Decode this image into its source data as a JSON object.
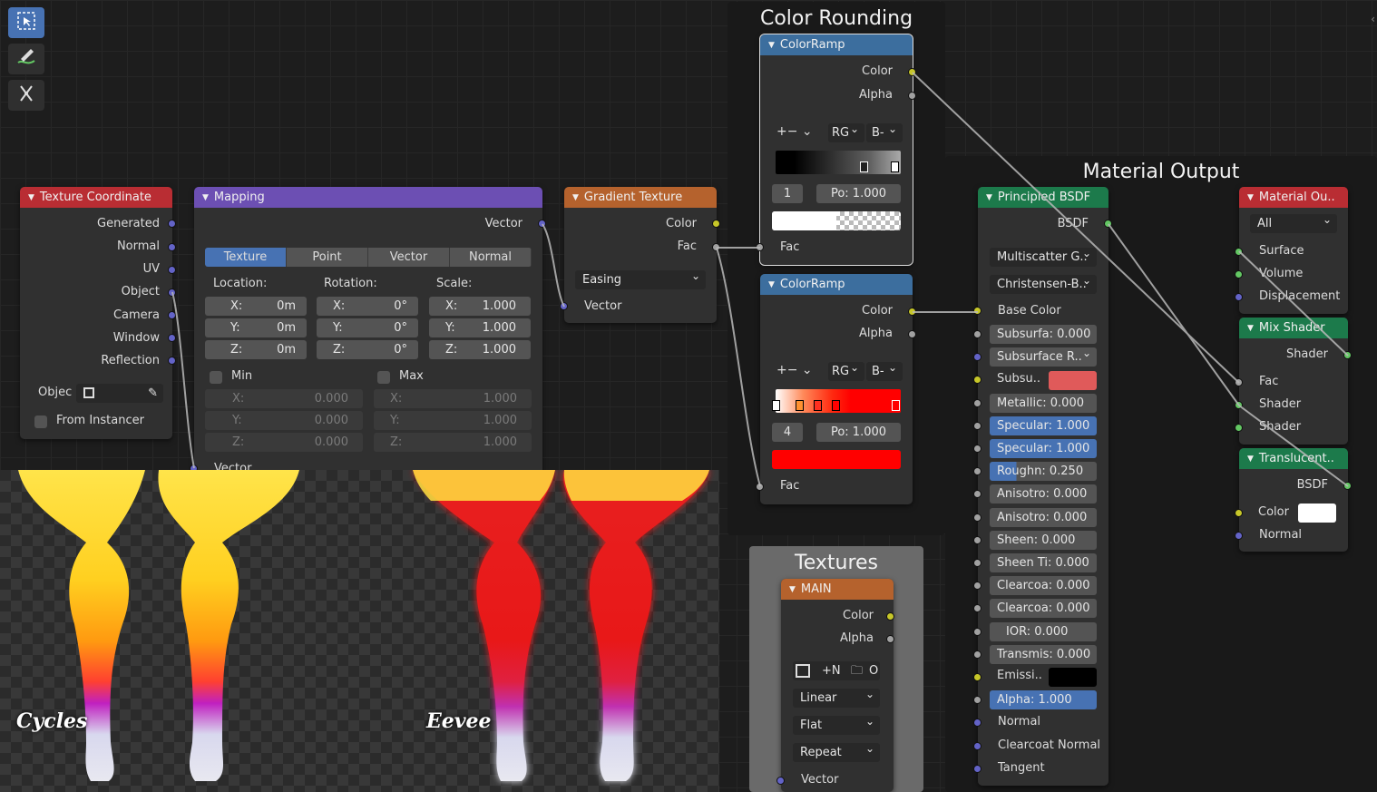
{
  "frames": {
    "color_rounding": "Color Rounding",
    "material_output": "Material Output",
    "textures": "Textures"
  },
  "toolbar": [
    "select-box-icon",
    "annotate-icon",
    "cut-links-icon"
  ],
  "texture_coordinate": {
    "title": "Texture Coordinate",
    "outputs": [
      "Generated",
      "Normal",
      "UV",
      "Object",
      "Camera",
      "Window",
      "Reflection"
    ],
    "object_label": "Objec",
    "from_instancer": "From Instancer"
  },
  "mapping": {
    "title": "Mapping",
    "output": "Vector",
    "types": [
      "Texture",
      "Point",
      "Vector",
      "Normal"
    ],
    "location_label": "Location:",
    "rotation_label": "Rotation:",
    "scale_label": "Scale:",
    "location": [
      {
        "axis": "X:",
        "value": "0m"
      },
      {
        "axis": "Y:",
        "value": "0m"
      },
      {
        "axis": "Z:",
        "value": "0m"
      }
    ],
    "rotation": [
      {
        "axis": "X:",
        "value": "0°"
      },
      {
        "axis": "Y:",
        "value": "0°"
      },
      {
        "axis": "Z:",
        "value": "0°"
      }
    ],
    "scale": [
      {
        "axis": "X:",
        "value": "1.000"
      },
      {
        "axis": "Y:",
        "value": "1.000"
      },
      {
        "axis": "Z:",
        "value": "1.000"
      }
    ],
    "min_label": "Min",
    "max_label": "Max",
    "min": [
      {
        "axis": "X:",
        "value": "0.000"
      },
      {
        "axis": "Y:",
        "value": "0.000"
      },
      {
        "axis": "Z:",
        "value": "0.000"
      }
    ],
    "max": [
      {
        "axis": "X:",
        "value": "1.000"
      },
      {
        "axis": "Y:",
        "value": "1.000"
      },
      {
        "axis": "Z:",
        "value": "1.000"
      }
    ],
    "input": "Vector"
  },
  "gradient": {
    "title": "Gradient Texture",
    "out_color": "Color",
    "out_fac": "Fac",
    "type": "Easing",
    "input": "Vector"
  },
  "ramp1": {
    "title": "ColorRamp",
    "out_color": "Color",
    "out_alpha": "Alpha",
    "add_remove": "+−",
    "color_mode": "RG",
    "interp": "B-",
    "index": "1",
    "pos": "Po: 1.000",
    "input": "Fac"
  },
  "ramp2": {
    "title": "ColorRamp",
    "out_color": "Color",
    "out_alpha": "Alpha",
    "add_remove": "+−",
    "color_mode": "RG",
    "interp": "B-",
    "index": "4",
    "pos": "Po: 1.000",
    "input": "Fac"
  },
  "image_tex": {
    "title": "MAIN",
    "out_color": "Color",
    "out_alpha": "Alpha",
    "new_label": "+N",
    "open_label": "O",
    "interpolation": "Linear",
    "projection": "Flat",
    "extension": "Repeat",
    "input": "Vector"
  },
  "principled": {
    "title": "Principled BSDF",
    "output": "BSDF",
    "distribution": "Multiscatter G..",
    "subsurface_method": "Christensen-B..",
    "base_color": "Base Color",
    "subsurface": "Subsurfa: 0.000",
    "subsurface_radius": "Subsurface R..",
    "subsurface_color": "Subsu..",
    "metallic": "Metallic:  0.000",
    "specular": "Specular: 1.000",
    "specular_tint": "Specular: 1.000",
    "roughness": "Roughn:  0.250",
    "anisotropic": "Anisotro:  0.000",
    "anisotropic_rot": "Anisotro:  0.000",
    "sheen": "Sheen:     0.000",
    "sheen_tint": "Sheen Ti: 0.000",
    "clearcoat": "Clearcoa: 0.000",
    "clearcoat_rough": "Clearcoa: 0.000",
    "ior": "IOR:      0.000",
    "transmission": "Transmis: 0.000",
    "emission": "Emissi..",
    "alpha": "Alpha:       1.000",
    "normal": "Normal",
    "clearcoat_normal": "Clearcoat Normal",
    "tangent": "Tangent"
  },
  "material_output": {
    "title": "Material Ou..",
    "target": "All",
    "inputs": [
      "Surface",
      "Volume",
      "Displacement"
    ]
  },
  "mix_shader": {
    "title": "Mix Shader",
    "output": "Shader",
    "inputs": [
      "Fac",
      "Shader",
      "Shader"
    ]
  },
  "translucent": {
    "title": "Translucent..",
    "output": "BSDF",
    "color": "Color",
    "normal": "Normal"
  },
  "render": {
    "left_label": "Cycles",
    "right_label": "Eevee"
  },
  "colors": {
    "accent": "#4772b3",
    "socket_color": "#c7c729",
    "socket_shader": "#63c763",
    "socket_vector": "#6363c7",
    "socket_float": "#a1a1a1",
    "subsurface_color": "#e05a5a",
    "emission_color": "#000000",
    "translucent_color": "#ffffff",
    "ramp2_color": "#ff0000"
  }
}
